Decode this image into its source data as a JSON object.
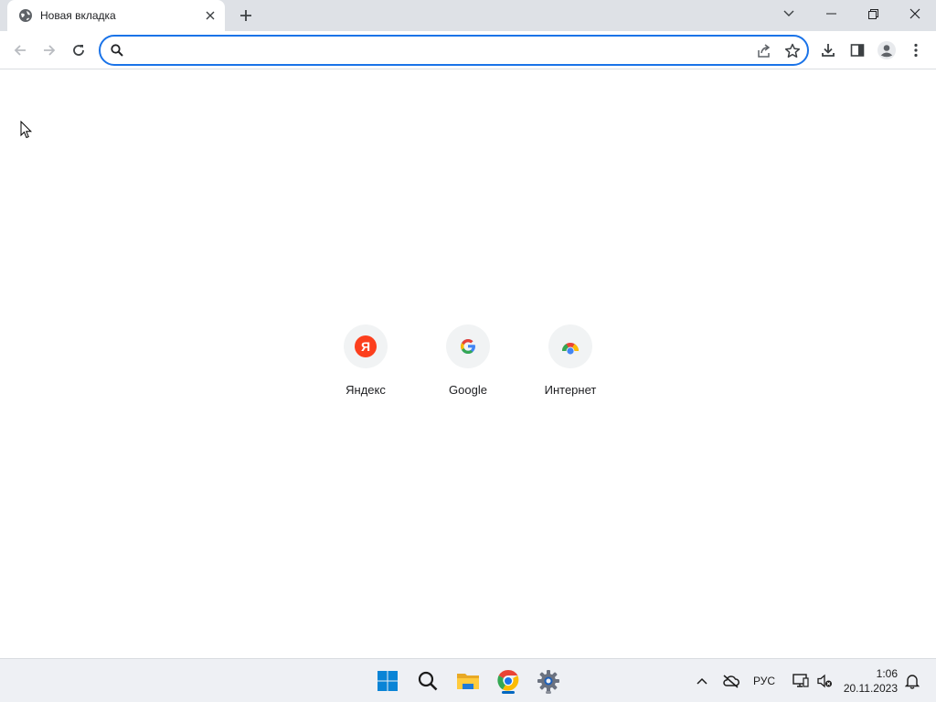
{
  "tab": {
    "title": "Новая вкладка",
    "icon": "globe-icon"
  },
  "window_controls": [
    "tab-search",
    "minimize",
    "restore",
    "close"
  ],
  "omnibox": {
    "value": "",
    "placeholder": ""
  },
  "shortcuts": [
    {
      "label": "Яндекс",
      "icon": "yandex-icon"
    },
    {
      "label": "Google",
      "icon": "google-icon"
    },
    {
      "label": "Интернет",
      "icon": "internet-icon"
    }
  ],
  "taskbar": {
    "apps": [
      "start",
      "search",
      "file-explorer",
      "chrome",
      "settings"
    ],
    "language": "РУС",
    "time": "1:06",
    "date": "20.11.2023"
  },
  "colors": {
    "accent": "#1a73e8",
    "tabstrip": "#dee1e6",
    "taskbar": "#eef0f4"
  }
}
